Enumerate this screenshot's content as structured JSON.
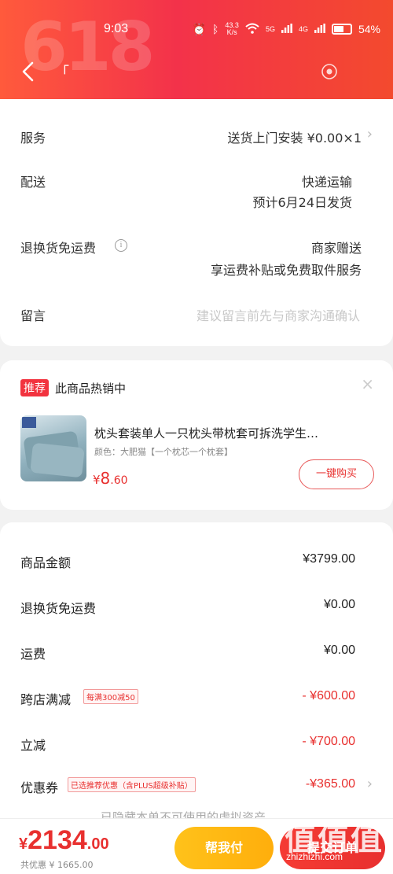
{
  "status_bar": {
    "time": "9:03",
    "net_speed_top": "43.3",
    "net_speed_bottom": "K/s",
    "sig1": "5G",
    "sig2": "4G",
    "battery": "54%"
  },
  "header": {
    "bg_text": "618",
    "shop_title": "「"
  },
  "order_info": {
    "service_label": "服务",
    "service_value": "送货上门安装 ¥0.00×1",
    "delivery_label": "配送",
    "delivery_method": "快递运输",
    "delivery_eta": "预计6月24日发货",
    "return_label": "退换货免运费",
    "return_value": "商家赠送",
    "return_sub": "享运费补贴或免费取件服务",
    "message_label": "留言",
    "message_placeholder": "建议留言前先与商家沟通确认"
  },
  "recommend": {
    "badge": "推荐",
    "title": "此商品热销中",
    "product_name": "枕头套装单人一只枕头带枕套可拆洗学生…",
    "variant": "颜色：大肥猫【一个枕芯一个枕套】",
    "price_currency": "¥",
    "price_int": "8",
    "price_dec": ".60",
    "buy_button": "一键购买",
    "close": "×"
  },
  "summary": {
    "goods_label": "商品金额",
    "goods_value": "¥3799.00",
    "return_fee_label": "退换货免运费",
    "return_fee_value": "¥0.00",
    "shipping_label": "运费",
    "shipping_value": "¥0.00",
    "cross_label": "跨店满减",
    "cross_tag": "每满300减50",
    "cross_value": "- ¥600.00",
    "instant_label": "立减",
    "instant_value": "- ¥700.00",
    "coupon_label": "优惠券",
    "coupon_tag": "已选推荐优惠（含PLUS超级补贴）",
    "coupon_value": "-¥365.00",
    "faded_note": "已隐藏本单不可使用的虚拟资产"
  },
  "bottom": {
    "currency": "¥",
    "total_int": "2134",
    "total_dec": ".00",
    "discount_note": "共优惠 ¥ 1665.00",
    "help_pay": "帮我付",
    "submit": "提交订单"
  },
  "watermark": {
    "logo": "值值值",
    "site": "zhizhizhi.com"
  },
  "colors": {
    "brand_red": "#e8302f",
    "header_start": "#ff5a3c",
    "header_end": "#f34a2e",
    "help_pay_yellow": "#ffb414"
  }
}
